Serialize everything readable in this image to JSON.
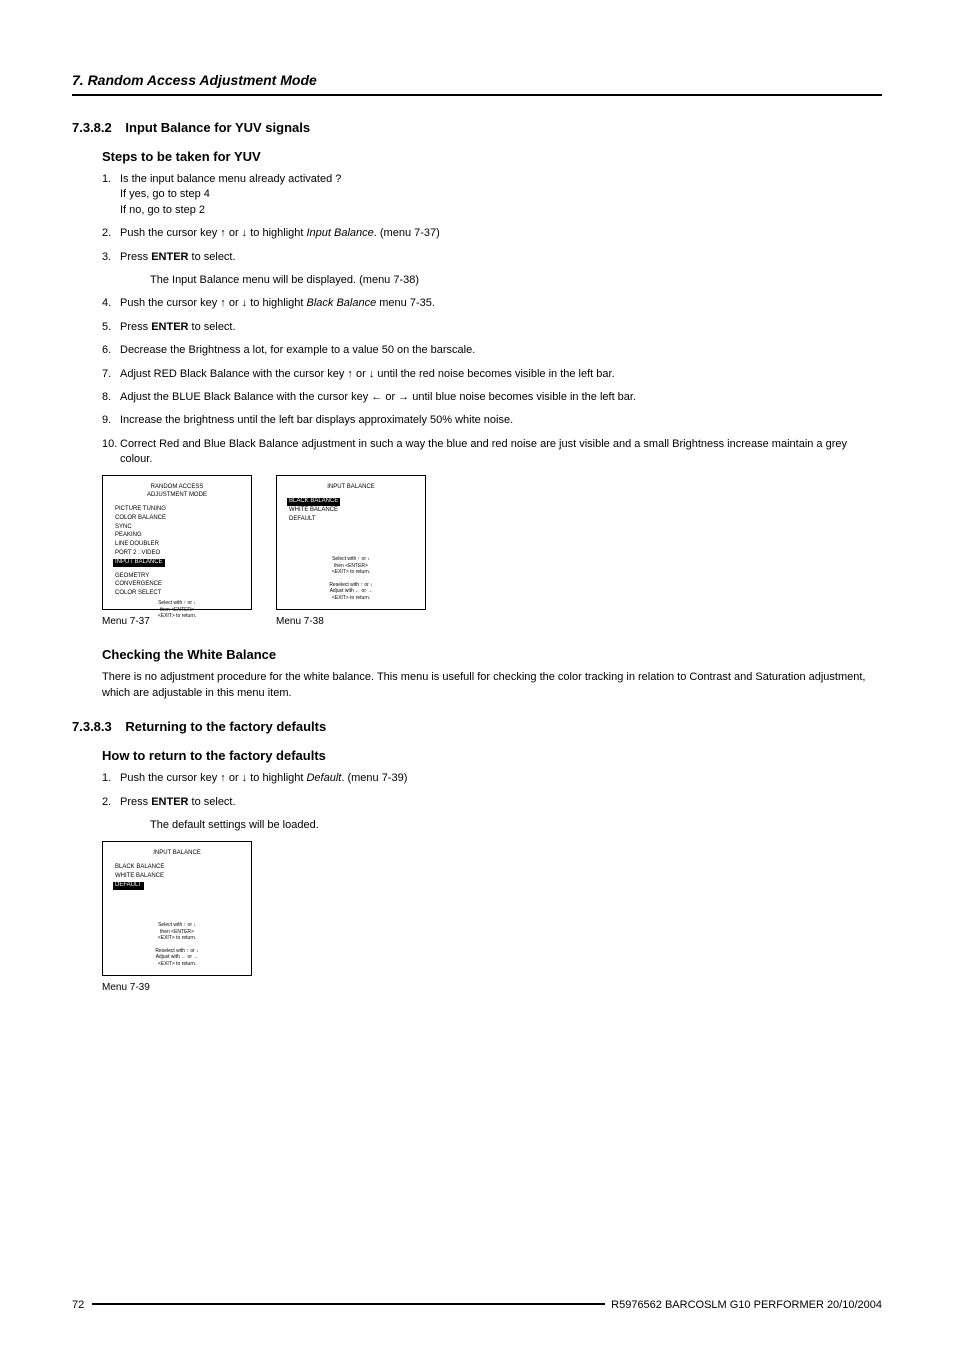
{
  "chapter": "7. Random Access Adjustment Mode",
  "section_7382": {
    "num": "7.3.8.2",
    "title": "Input Balance for YUV signals",
    "sub1": "Steps to be taken for YUV",
    "steps": [
      {
        "n": "1.",
        "text": "Is the input balance menu already activated ?",
        "subs": [
          "If yes, go to step 4",
          "If no, go to step 2"
        ]
      },
      {
        "n": "2.",
        "pre": "Push the cursor key ↑ or ↓ to highlight ",
        "em": "Input Balance",
        "post": ".  (menu 7-37)"
      },
      {
        "n": "3.",
        "pre": "Press ",
        "bold": "ENTER",
        "post": " to select.",
        "after": "The Input Balance menu will be displayed.  (menu 7-38)"
      },
      {
        "n": "4.",
        "pre": "Push the cursor key ↑ or ↓ to highlight ",
        "em": "Black Balance",
        "post": " menu 7-35."
      },
      {
        "n": "5.",
        "pre": "Press ",
        "bold": "ENTER",
        "post": " to select."
      },
      {
        "n": "6.",
        "text": "Decrease the Brightness a lot, for example to a value 50 on the barscale."
      },
      {
        "n": "7.",
        "text": "Adjust RED Black Balance with the cursor key ↑ or ↓ until the red noise becomes visible in the left bar."
      },
      {
        "n": "8.",
        "text": "Adjust the BLUE Black Balance with the cursor key ← or → until blue noise becomes visible in the left bar."
      },
      {
        "n": "9.",
        "text": "Increase the brightness until the left bar displays approximately 50% white noise."
      },
      {
        "n": "10.",
        "text": "Correct Red and Blue Black Balance adjustment in such a way the blue and red noise are just visible and a small Brightness increase maintain a grey colour."
      }
    ],
    "menu37": {
      "title": "RANDOM ACCESS\nADJUSTMENT MODE",
      "items": [
        "PICTURE TUNING",
        "COLOR BALANCE",
        "SYNC",
        "PEAKING",
        "LINE DOUBLER",
        "PORT 2 : VIDEO",
        "INPUT BALANCE"
      ],
      "selectedIndex": 6,
      "postItems": [
        "GEOMETRY",
        "CONVERGENCE",
        "COLOR SELECT"
      ],
      "hintA": "Select with ↑ or ↓\nthen <ENTER>\n<EXIT> to return.",
      "caption": "Menu 7-37"
    },
    "menu38": {
      "title": "INPUT BALANCE",
      "items": [
        "BLACK BALANCE",
        "WHITE BALANCE",
        "DEFAULT"
      ],
      "selectedIndex": 0,
      "hintA": "Select with ↑ or ↓\nthen <ENTER>\n<EXIT> to return.",
      "hintB": "Reselect with ↑ or ↓\nAdjust with ← or →\n<EXIT> to return.",
      "caption": "Menu 7-38"
    },
    "sub2": "Checking the White Balance",
    "body2": "There is no adjustment procedure for the white balance. This menu is usefull for checking the color tracking in relation to Contrast and Saturation adjustment, which are adjustable in this menu item."
  },
  "section_7383": {
    "num": "7.3.8.3",
    "title": "Returning to the factory defaults",
    "sub1": "How to return to the factory defaults",
    "steps": [
      {
        "n": "1.",
        "pre": "Push the cursor key ↑ or ↓ to highlight ",
        "em": "Default",
        "post": ".  (menu 7-39)"
      },
      {
        "n": "2.",
        "pre": "Press ",
        "bold": "ENTER",
        "post": " to select.",
        "after": "The default settings will be loaded."
      }
    ],
    "menu39": {
      "title": "INPUT BALANCE",
      "items": [
        "BLACK BALANCE",
        "WHITE BALANCE",
        "DEFAULT"
      ],
      "selectedIndex": 2,
      "hintA": "Select with ↑ or ↓\nthen <ENTER>\n<EXIT> to return.",
      "hintB": "Reselect with ↑ or ↓\nAdjust with ← or →\n<EXIT> to return.",
      "caption": "Menu 7-39"
    }
  },
  "footer": {
    "page": "72",
    "text": "R5976562  BARCOSLM G10 PERFORMER  20/10/2004"
  }
}
